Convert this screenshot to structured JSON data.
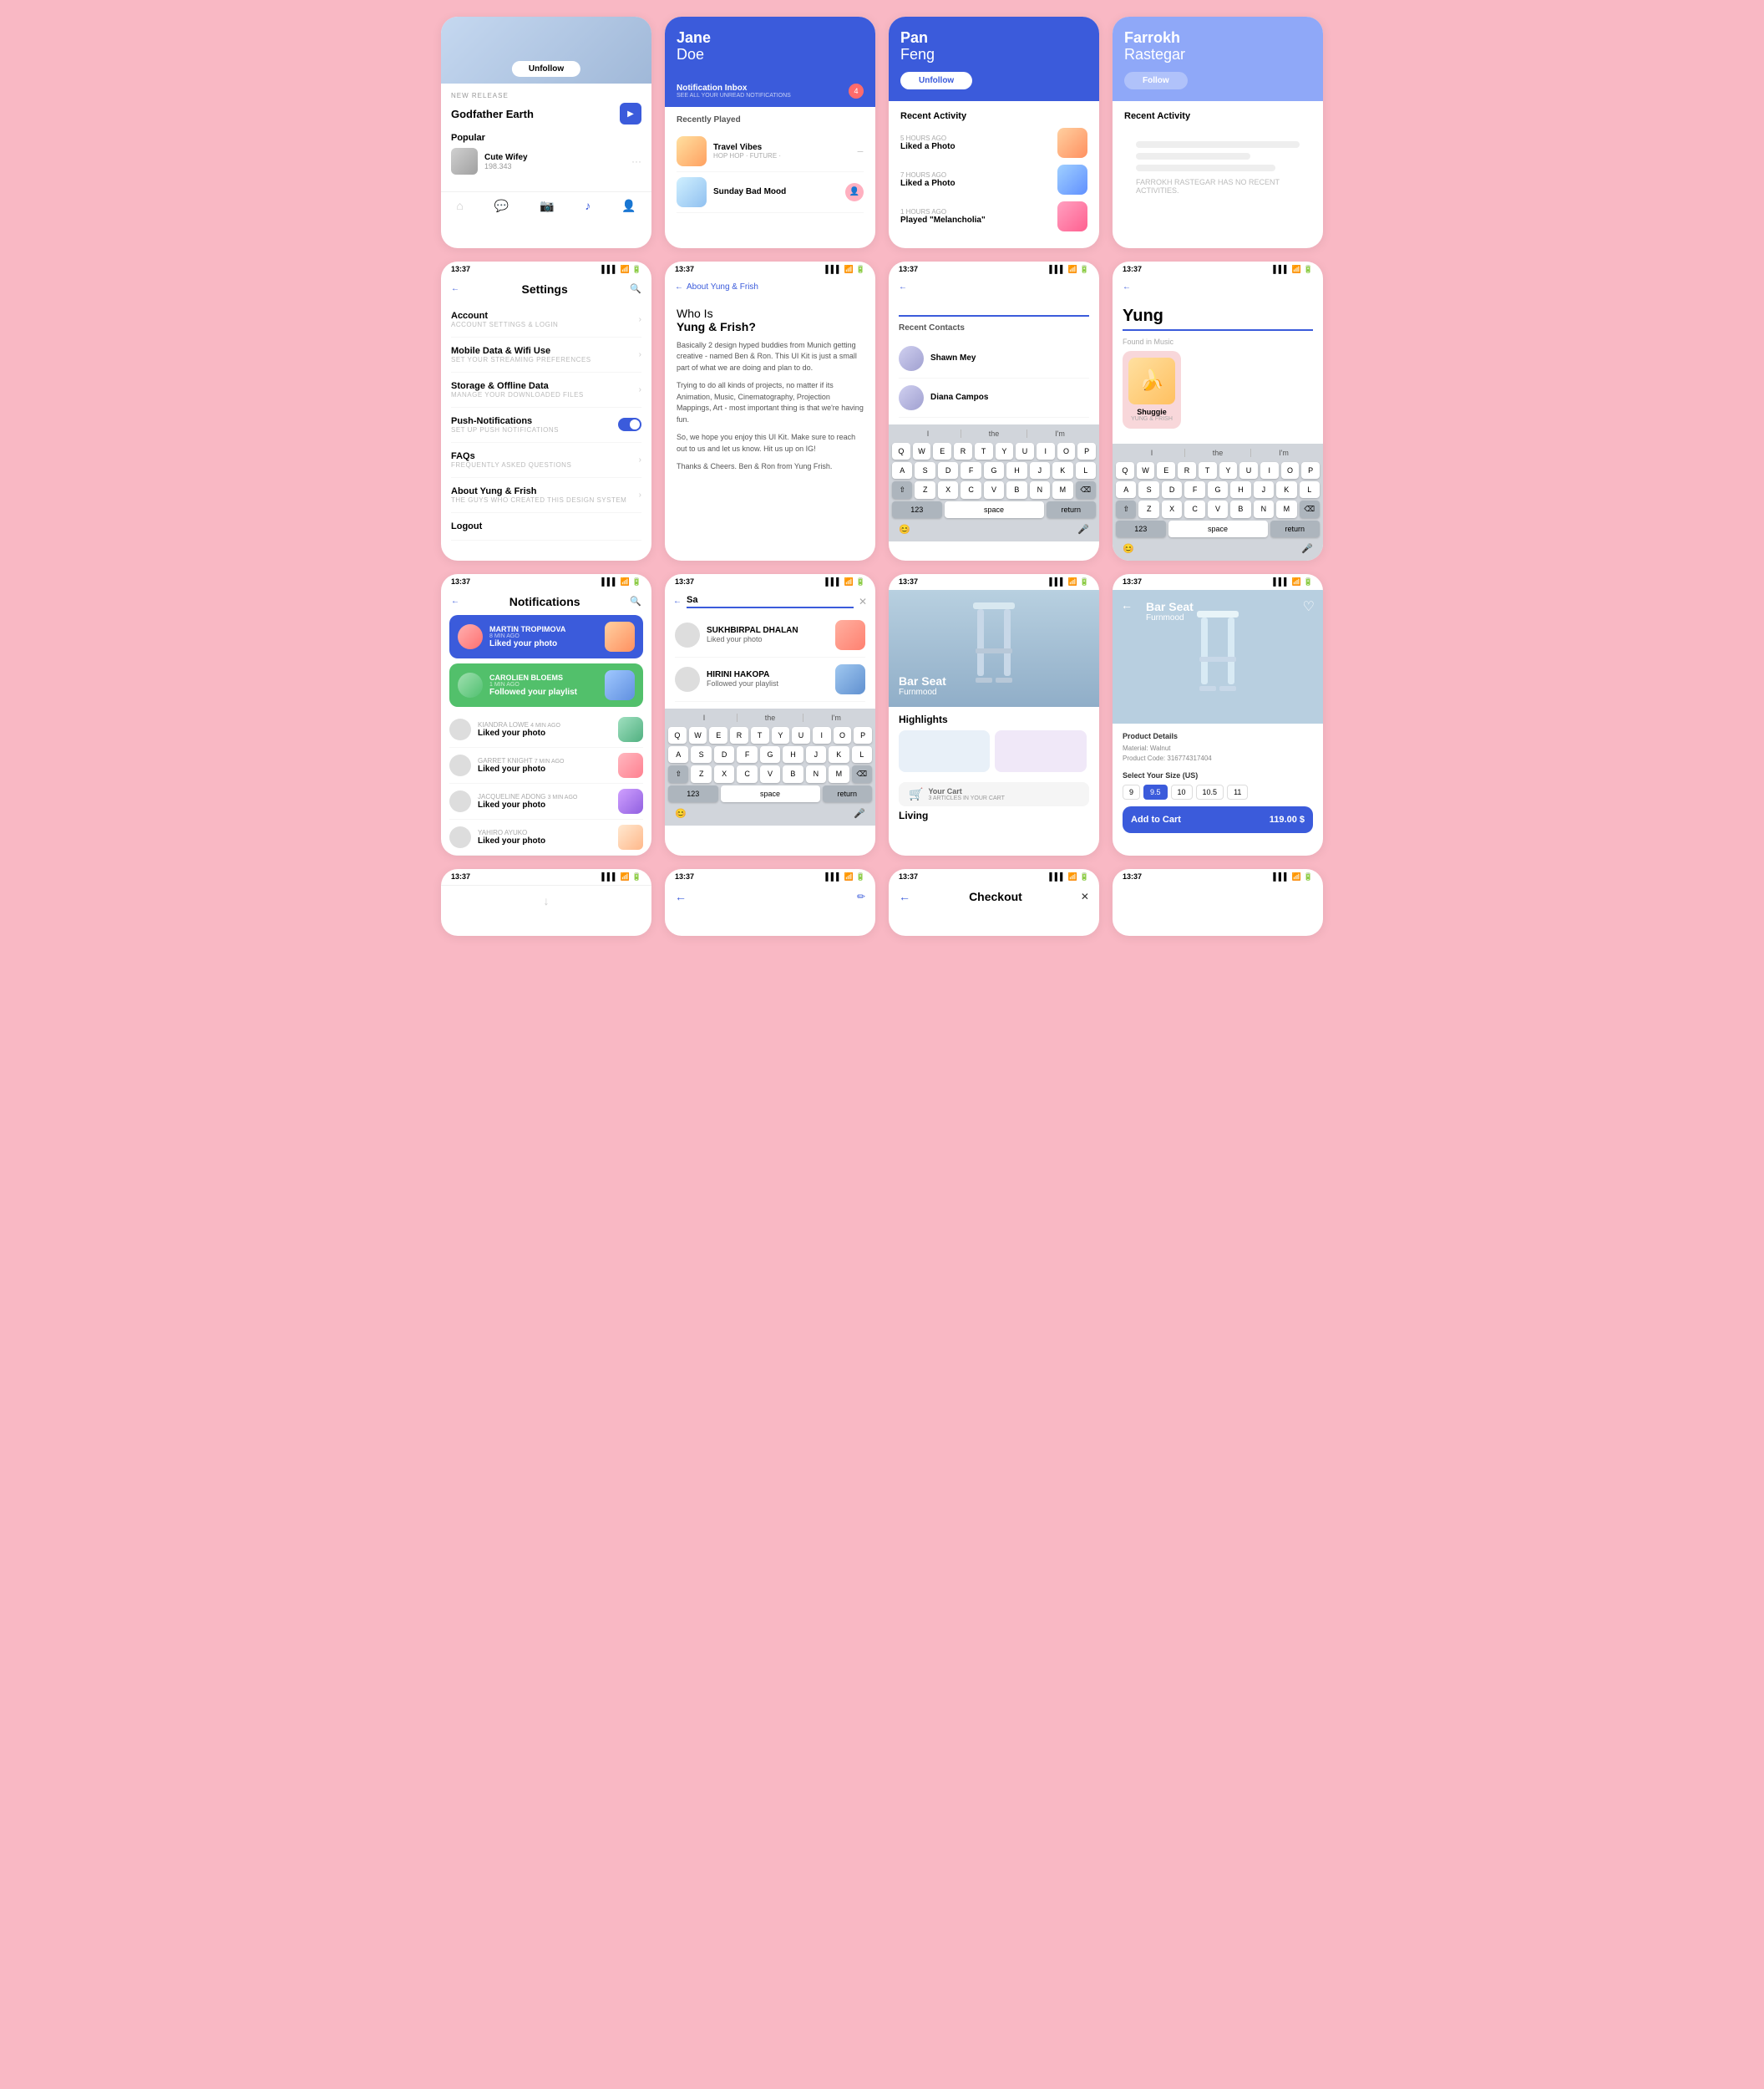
{
  "background": "#f9b8c4",
  "row1": {
    "music_profile": {
      "unfollow_label": "Unfollow",
      "new_release_label": "NEW RELEASE",
      "godfather_earth": "Godfather Earth",
      "popular_label": "Popular",
      "popular_track": "Cute Wifey",
      "popular_count": "198.343"
    },
    "jane": {
      "first_name": "Jane",
      "last_name": "Doe",
      "notification_inbox": "Notification Inbox",
      "see_all": "SEE ALL YOUR UNREAD NOTIFICATIONS",
      "recently_played": "Recently Played",
      "travel_vibes": "Travel Vibes",
      "travel_genre": "HOP HOP · FUTURE ·",
      "sunday_bad_mood": "Sunday Bad Mood"
    },
    "pan": {
      "first_name": "Pan",
      "last_name": "Feng",
      "unfollow_label": "Unfollow",
      "recent_activity": "Recent Activity",
      "activity1_time": "5 HOURS AGO",
      "activity1_desc": "Liked a Photo",
      "activity2_time": "7 HOURS AGO",
      "activity2_desc": "Liked a Photo",
      "activity3_time": "1 HOURS AGO",
      "activity3_desc": "Played \"Melancholia\""
    },
    "farrokh": {
      "first_name": "Farrokh",
      "last_name": "Rastegar",
      "follow_label": "Follow",
      "recent_activity": "Recent Activity",
      "empty_note": "FARROKH RASTEGAR HAS NO RECENT ACTIVITIES."
    }
  },
  "row2": {
    "settings": {
      "title": "Settings",
      "time": "13:37",
      "items": [
        {
          "label": "Account",
          "sub": "ACCOUNT SETTINGS & LOGIN"
        },
        {
          "label": "Mobile Data & Wifi Use",
          "sub": "SET YOUR STREAMING PREFERENCES"
        },
        {
          "label": "Storage & Offline Data",
          "sub": "MANAGE YOUR DOWNLOADED FILES"
        },
        {
          "label": "Push-Notifications",
          "sub": "SET UP PUSH NOTIFICATIONS",
          "toggle": true
        },
        {
          "label": "FAQs",
          "sub": "FREQUENTLY ASKED QUESTIONS"
        },
        {
          "label": "About Yung & Frish",
          "sub": "THE GUYS WHO CREATED THIS DESIGN SYSTEM"
        },
        {
          "label": "Logout"
        }
      ]
    },
    "about": {
      "title": "About Yung & Frish",
      "time": "13:37",
      "headline1": "Who Is",
      "headline2": "Yung & Frish?",
      "body1": "Basically 2 design hyped buddies from Munich getting creative - named Ben & Ron. This UI Kit is just a small part of what we are doing and plan to do.",
      "body2": "Trying to do all kinds of projects, no matter if its Animation, Music, Cinematography, Projection Mappings, Art - most important thing is that we're having fun.",
      "body3": "So, we hope you enjoy this UI Kit. Make sure to reach out to us and let us know. Hit us up on IG!",
      "sign": "Thanks & Cheers.\nBen & Ron from Yung Frish."
    },
    "search_contacts": {
      "time": "13:37",
      "recent_contacts": "Recent Contacts",
      "contact1": "Shawn Mey",
      "contact2": "Diana Campos",
      "keyboard_suggest": [
        "I",
        "the",
        "I'm"
      ],
      "keyboard_rows": [
        [
          "Q",
          "W",
          "E",
          "R",
          "T",
          "Y",
          "U",
          "I",
          "O",
          "P"
        ],
        [
          "A",
          "S",
          "D",
          "F",
          "G",
          "H",
          "J",
          "K",
          "L"
        ],
        [
          "⇧",
          "Z",
          "X",
          "C",
          "V",
          "B",
          "N",
          "M",
          "⌫"
        ],
        [
          "123",
          "space",
          "return"
        ]
      ]
    },
    "yung_search": {
      "time": "13:37",
      "search_query": "Yung",
      "found_in": "Found in Music",
      "album_name": "Shuggie",
      "album_sub": "YUNG & FRISH",
      "keyboard_suggest": [
        "I",
        "the",
        "I'm"
      ],
      "keyboard_rows": [
        [
          "Q",
          "W",
          "E",
          "R",
          "T",
          "Y",
          "U",
          "I",
          "O",
          "P"
        ],
        [
          "A",
          "S",
          "D",
          "F",
          "G",
          "H",
          "J",
          "K",
          "L"
        ],
        [
          "⇧",
          "Z",
          "X",
          "C",
          "V",
          "B",
          "N",
          "M",
          "⌫"
        ],
        [
          "123",
          "space",
          "return"
        ]
      ]
    }
  },
  "row3": {
    "notifications": {
      "title": "Notifications",
      "time": "13:37",
      "items": [
        {
          "user": "MARTIN TROPIMOVA",
          "time": "8 MIN AGO",
          "action": "Liked your photo",
          "highlight": true,
          "avatar_color": "red"
        },
        {
          "user": "CAROLIEN BLOEMS",
          "time": "1 MIN AGO",
          "action": "Followed your playlist",
          "highlight": true,
          "avatar_color": "green"
        },
        {
          "user": "KIANDRA LOWE",
          "time": "4 MIN AGO",
          "action": "Liked your photo"
        },
        {
          "user": "GARRET KNIGHT",
          "time": "7 MIN AGO",
          "action": "Liked your photo"
        },
        {
          "user": "JACQUELINE ADONG",
          "time": "3 MIN AGO",
          "action": "Liked your photo"
        },
        {
          "user": "YAHIRO AYUKO",
          "time": "",
          "action": "Liked your photo"
        }
      ]
    },
    "search_sa": {
      "time": "13:37",
      "search_value": "Sa",
      "results": [
        {
          "user": "SUKHBIRPAL DHALAN",
          "action": "Liked your photo"
        },
        {
          "user": "HIRINI HAKOPA",
          "action": "Followed your playlist"
        }
      ],
      "keyboard_suggest": [
        "I",
        "the",
        "I'm"
      ],
      "keyboard_rows": [
        [
          "Q",
          "W",
          "E",
          "R",
          "T",
          "Y",
          "U",
          "I",
          "O",
          "P"
        ],
        [
          "A",
          "S",
          "D",
          "F",
          "G",
          "H",
          "J",
          "K",
          "L"
        ],
        [
          "⇧",
          "Z",
          "X",
          "C",
          "V",
          "B",
          "N",
          "M",
          "⌫"
        ],
        [
          "123",
          "space",
          "return"
        ]
      ]
    },
    "product_list": {
      "time": "13:37",
      "product_name": "Bar Seat",
      "product_brand": "Furnmood",
      "highlights_title": "Highlights",
      "cart_text": "Your Cart",
      "cart_sub": "3 ARTICLES IN YOUR CART",
      "living_label": "Living"
    },
    "product_detail": {
      "time": "13:37",
      "product_name": "Bar Seat",
      "product_brand": "Furnmood",
      "details_title": "Product Details",
      "material": "Material: Walnut",
      "product_code": "Product Code: 316774317404",
      "size_label": "Select Your Size (US)",
      "sizes": [
        "9",
        "9.5",
        "10",
        "10.5",
        "11"
      ],
      "active_size": "9.5",
      "add_to_cart": "Add to Cart",
      "price": "119.00 $"
    }
  },
  "row4": {
    "card1": {
      "time": "13:37"
    },
    "card2": {
      "time": "13:37"
    },
    "card3": {
      "time": "13:37",
      "label": "Checkout"
    },
    "card4": {
      "time": "13:37"
    }
  },
  "icons": {
    "play": "▶",
    "back": "←",
    "search": "🔍",
    "heart": "♡",
    "home": "⌂",
    "chat": "💬",
    "camera": "📷",
    "music": "♪",
    "user": "👤",
    "close": "✕",
    "chevron_right": "›",
    "mic": "🎤",
    "emoji": "😊",
    "settings_gear": "⚙"
  }
}
